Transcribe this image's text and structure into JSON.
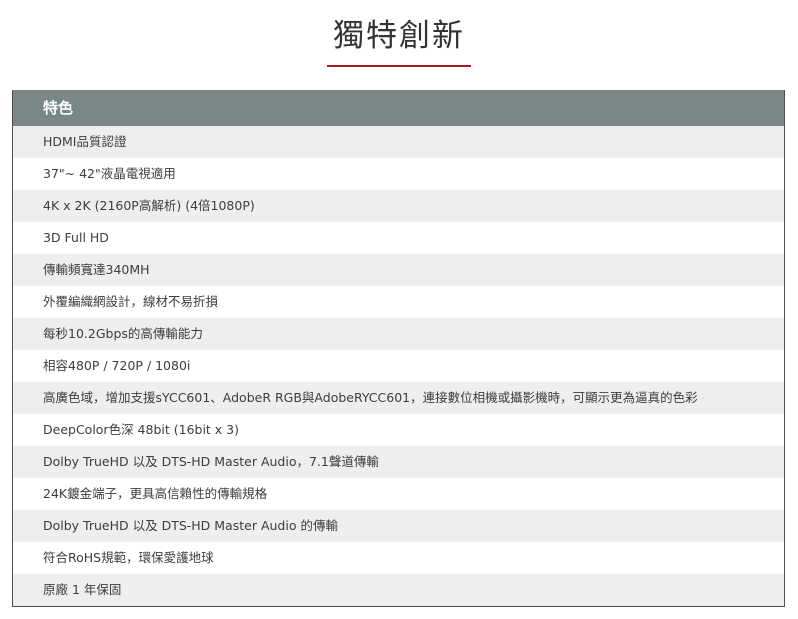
{
  "page": {
    "title": "獨特創新"
  },
  "spec_table": {
    "header": "特色",
    "rows": [
      "HDMI品質認證",
      "37\"~ 42\"液晶電視適用",
      "4K x 2K (2160P高解析) (4倍1080P)",
      "3D Full HD",
      "傳輸頻寬達340MH",
      "外覆編織網設計，線材不易折損",
      "每秒10.2Gbps的高傳輸能力",
      "相容480P / 720P / 1080i",
      "高廣色域，增加支援sYCC601、AdobeR RGB與AdobeRYCC601，連接數位相機或攝影機時，可顯示更為逼真的色彩",
      "DeepColor色深 48bit (16bit x 3)",
      "Dolby TrueHD 以及 DTS-HD Master Audio，7.1聲道傳輸",
      "24K鍍金端子，更具高信賴性的傳輸規格",
      "Dolby TrueHD 以及 DTS-HD Master Audio 的傳輸",
      "符合RoHS規範，環保愛護地球",
      "原廠 1 年保固"
    ]
  },
  "colors": {
    "accent_underline": "#a61b1b",
    "header_bg": "#7a8787",
    "row_alt_bg": "#eeeeee"
  }
}
